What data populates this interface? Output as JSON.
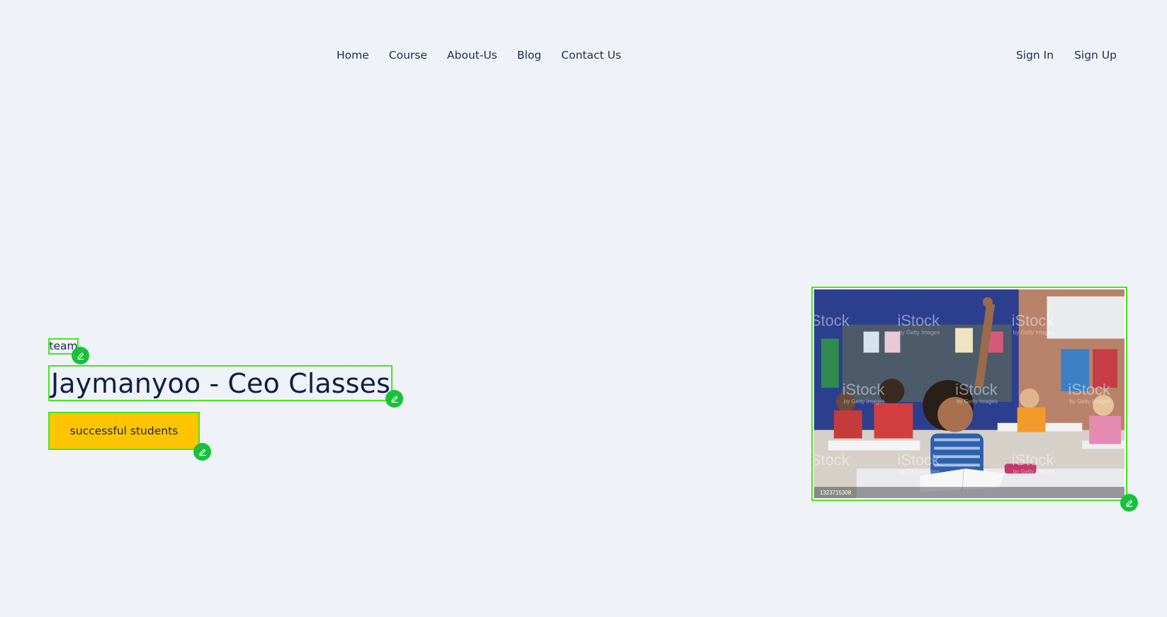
{
  "nav": {
    "main": [
      {
        "label": "Home"
      },
      {
        "label": "Course"
      },
      {
        "label": "About-Us"
      },
      {
        "label": "Blog"
      },
      {
        "label": "Contact Us"
      }
    ],
    "auth": [
      {
        "label": "Sign In"
      },
      {
        "label": "Sign Up"
      }
    ]
  },
  "hero": {
    "tag": "team",
    "title": "Jaymanyoo - Ceo Classes",
    "cta_label": "successful students",
    "image": {
      "watermark": "iStock",
      "watermark_sub": "by Getty Images",
      "stock_id": "1323715308"
    }
  },
  "edit_icon": "pencil-icon",
  "colors": {
    "background": "#eff3f8",
    "text": "#172446",
    "accent_button": "#fcc500",
    "edit_outline": "#44e81f",
    "edit_badge": "#17c238"
  }
}
